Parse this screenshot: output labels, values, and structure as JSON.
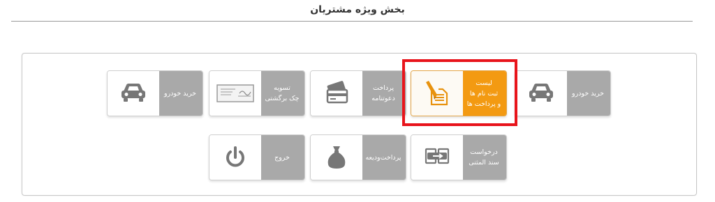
{
  "page": {
    "title": "بخش ویژه مشتریان"
  },
  "colors": {
    "accent": "#f39a12",
    "highlight": "#e8141b",
    "tile_label_bg": "#a9a9a9"
  },
  "tiles": {
    "car_purchase_right": {
      "label": "خرید خودرو",
      "icon": "car-icon"
    },
    "registration_list": {
      "line1": "لیست",
      "line2": "ثبت نام ها",
      "line3": "و پرداخت ها",
      "icon": "document-pen-icon"
    },
    "invitation_payment": {
      "line1": "پرداخت",
      "line2": "دعوتنامه",
      "icon": "card-icon"
    },
    "returned_check": {
      "line1": "تسویه",
      "line2": "چک برگشتی",
      "icon": "check-icon"
    },
    "car_purchase_left": {
      "label": "خرید خودرو",
      "icon": "car-icon"
    },
    "document_request": {
      "line1": "درخواست",
      "line2": "سند المثنی",
      "icon": "document-swap-icon"
    },
    "deposit_payment": {
      "label": "پرداخت‌ودیعه",
      "icon": "money-bag-icon"
    },
    "logout": {
      "label": "خروج",
      "icon": "power-icon"
    }
  }
}
